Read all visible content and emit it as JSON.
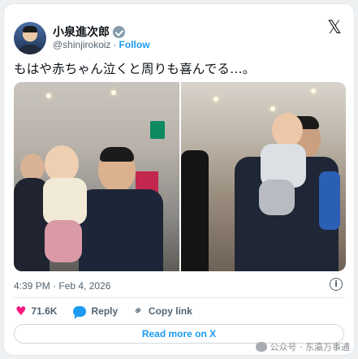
{
  "author": {
    "display_name": "小泉進次郎",
    "handle": "@shinjirokoiz",
    "separator": "·",
    "follow_label": "Follow",
    "verified_icon": "verified-badge-icon"
  },
  "brand": {
    "logo_glyph": "𝕏",
    "logo_icon": "x-logo-icon"
  },
  "tweet": {
    "text": "もはや赤ちゃん泣くと周りも喜んでる…。",
    "timestamp": "4:39 PM · Feb 4, 2026"
  },
  "actions": {
    "like_count": "71.6K",
    "reply_label": "Reply",
    "copy_link_label": "Copy link",
    "heart_glyph": "♥",
    "link_glyph": "⚭"
  },
  "info_glyph": "i",
  "read_more_label": "Read more on X",
  "watermark": "公众号 · 东瀛万事通",
  "colors": {
    "accent": "#1d9bf0",
    "like": "#f91880",
    "text": "#0f1419",
    "muted": "#536471"
  }
}
